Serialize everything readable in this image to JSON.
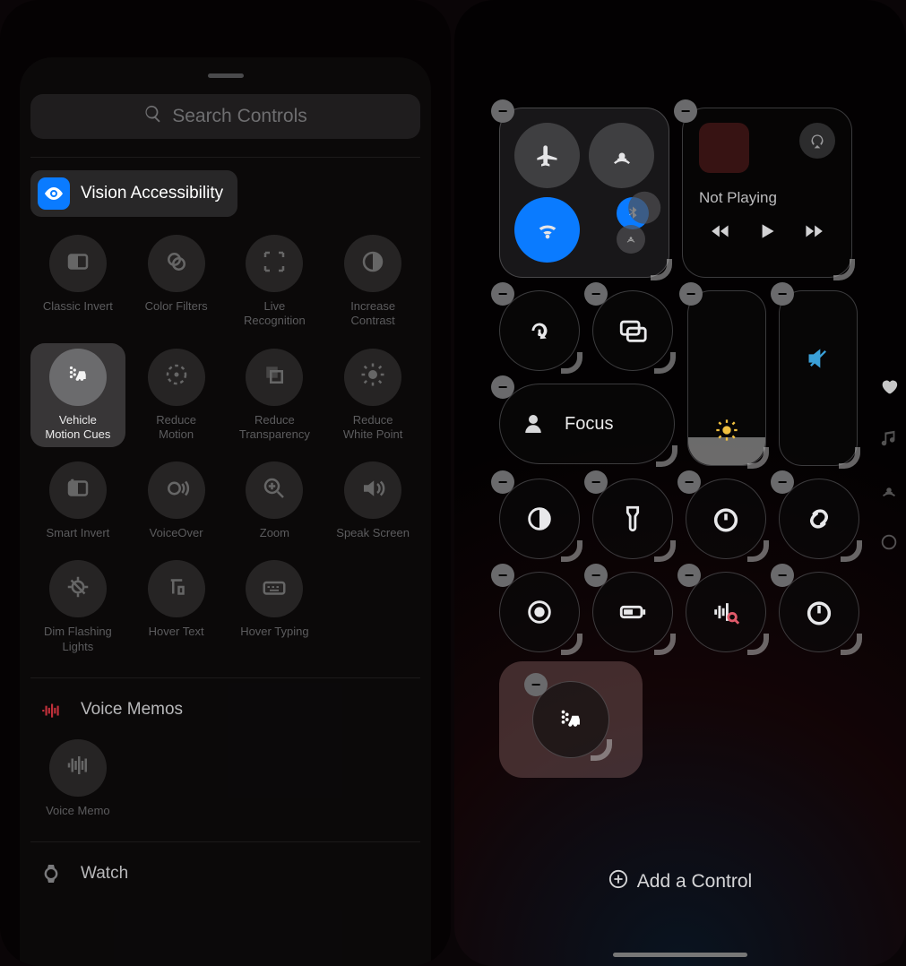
{
  "left": {
    "search_placeholder": "Search Controls",
    "section_title": "Vision Accessibility",
    "controls": [
      {
        "id": "classic-invert",
        "label": "Classic Invert"
      },
      {
        "id": "color-filters",
        "label": "Color Filters"
      },
      {
        "id": "live-recognition",
        "label": "Live\nRecognition"
      },
      {
        "id": "increase-contrast",
        "label": "Increase\nContrast"
      },
      {
        "id": "vehicle-motion-cues",
        "label": "Vehicle\nMotion Cues",
        "selected": true
      },
      {
        "id": "reduce-motion",
        "label": "Reduce\nMotion"
      },
      {
        "id": "reduce-transparency",
        "label": "Reduce\nTransparency"
      },
      {
        "id": "reduce-white-point",
        "label": "Reduce\nWhite Point"
      },
      {
        "id": "smart-invert",
        "label": "Smart Invert"
      },
      {
        "id": "voiceover",
        "label": "VoiceOver"
      },
      {
        "id": "zoom",
        "label": "Zoom"
      },
      {
        "id": "speak-screen",
        "label": "Speak Screen"
      },
      {
        "id": "dim-flashing-lights",
        "label": "Dim Flashing\nLights"
      },
      {
        "id": "hover-text",
        "label": "Hover Text"
      },
      {
        "id": "hover-typing",
        "label": "Hover Typing"
      }
    ],
    "other_sections": {
      "voice_memos": "Voice Memos",
      "voice_memo_btn": "Voice Memo",
      "watch": "Watch"
    }
  },
  "right": {
    "now_playing": "Not Playing",
    "focus_label": "Focus",
    "add_control_label": "Add a Control",
    "row1": {
      "connectivity": [
        "airplane",
        "airdrop",
        "wifi",
        "bluetooth",
        "cellular",
        "hotspot"
      ],
      "media_controls": [
        "rewind",
        "play",
        "forward"
      ]
    },
    "row2": {
      "left": [
        "orientation-lock",
        "screen-mirroring"
      ],
      "sliders": {
        "brightness_icon": "sun",
        "volume_icon": "speaker-mute",
        "brightness_level_pct": 16
      }
    },
    "row3": [
      "dark-mode",
      "flashlight",
      "timer",
      "shazam"
    ],
    "row4": [
      "screen-record",
      "low-power",
      "sound-recognition",
      "stopwatch"
    ],
    "highlight": "vehicle-motion-cues"
  }
}
